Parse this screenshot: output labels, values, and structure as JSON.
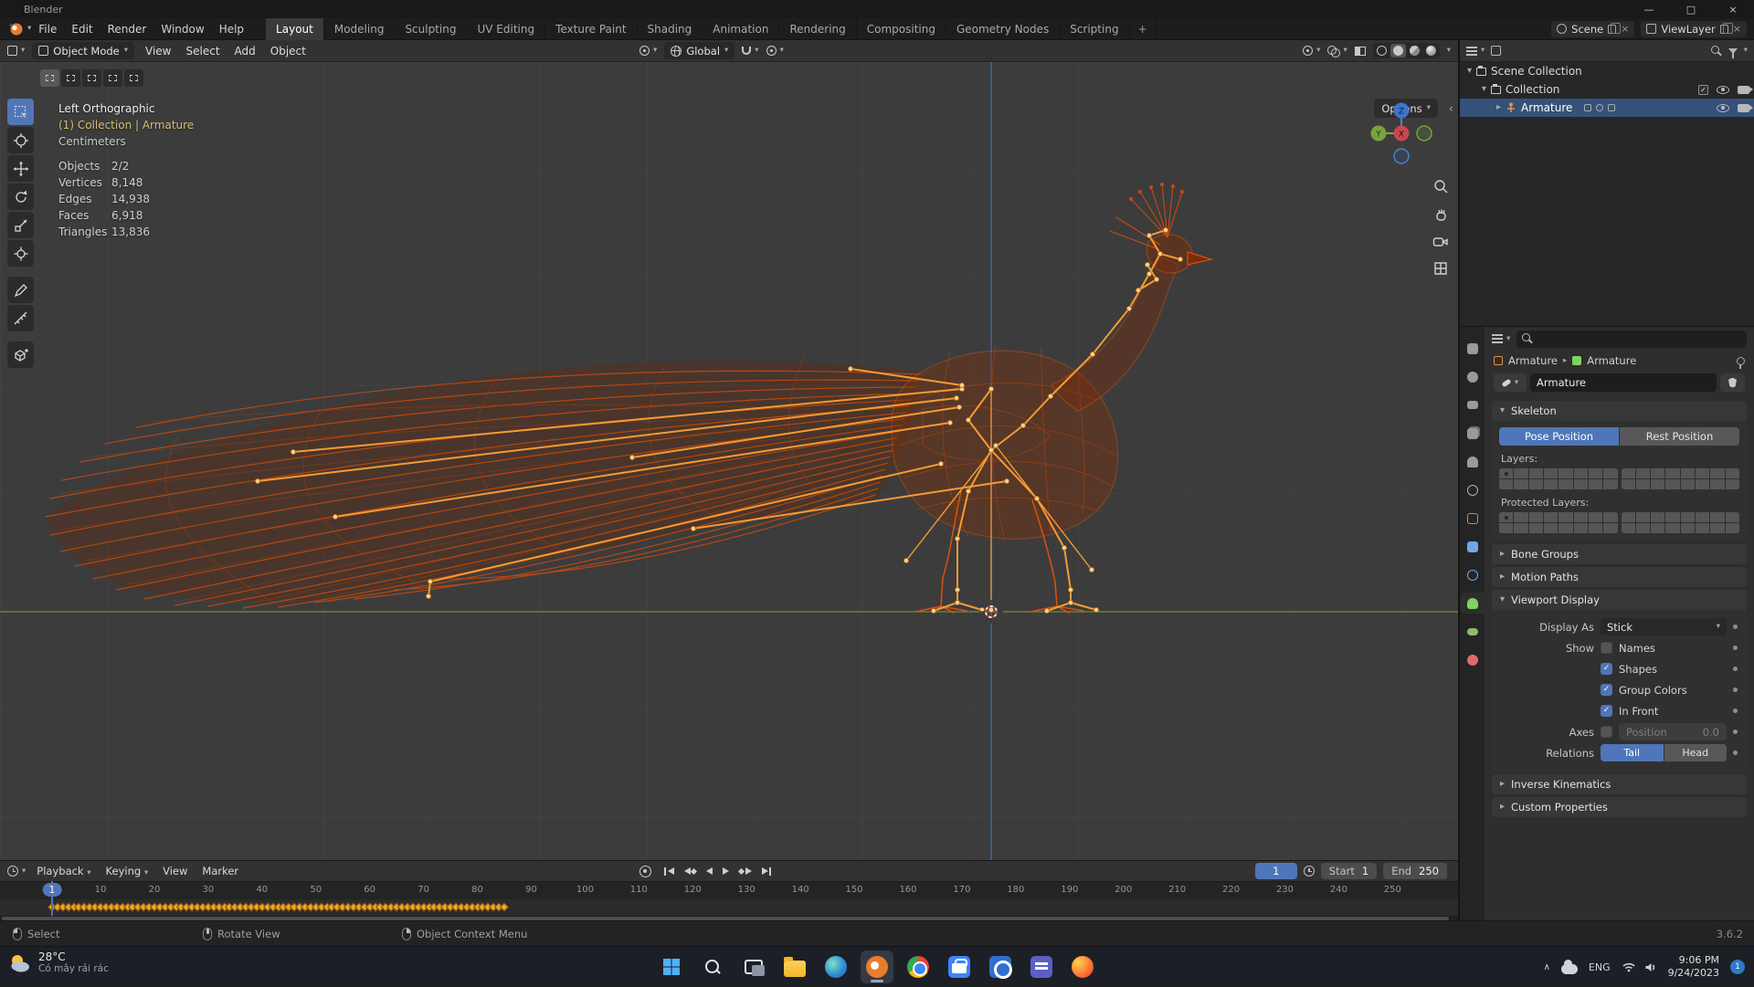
{
  "icons": {
    "chevron_down": "▾",
    "chevron_right": "▸",
    "chevron_left": "‹",
    "chevron_up": "∧",
    "check": "✓",
    "close": "×",
    "minimize": "—",
    "maximize": "□",
    "plus": "+"
  },
  "titlebar": {
    "app_name": "Blender"
  },
  "menubar": {
    "menus": [
      "File",
      "Edit",
      "Render",
      "Window",
      "Help"
    ],
    "workspaces": [
      "Layout",
      "Modeling",
      "Sculpting",
      "UV Editing",
      "Texture Paint",
      "Shading",
      "Animation",
      "Rendering",
      "Compositing",
      "Geometry Nodes",
      "Scripting"
    ],
    "scene_selector": {
      "label": "Scene"
    },
    "viewlayer_selector": {
      "label": "ViewLayer"
    }
  },
  "viewport": {
    "header": {
      "mode": "Object Mode",
      "menus": [
        "View",
        "Select",
        "Add",
        "Object"
      ],
      "orientation": "Global",
      "options_label": "Options"
    },
    "overlay": {
      "view_name": "Left Orthographic",
      "context": "(1) Collection | Armature",
      "units": "Centimeters",
      "stats": [
        {
          "label": "Objects",
          "value": "2/2"
        },
        {
          "label": "Vertices",
          "value": "8,148"
        },
        {
          "label": "Edges",
          "value": "14,938"
        },
        {
          "label": "Faces",
          "value": "6,918"
        },
        {
          "label": "Triangles",
          "value": "13,836"
        }
      ]
    },
    "gizmo": {
      "x": "X",
      "y": "Y",
      "z": "Z"
    }
  },
  "outliner": {
    "rows": [
      {
        "label": "Scene Collection"
      },
      {
        "label": "Collection"
      },
      {
        "label": "Armature"
      }
    ]
  },
  "properties": {
    "breadcrumb": {
      "object": "Armature",
      "data": "Armature"
    },
    "name_value": "Armature",
    "skeleton": {
      "title": "Skeleton",
      "pose_position": "Pose Position",
      "rest_position": "Rest Position",
      "layers_label": "Layers:",
      "protected_layers_label": "Protected Layers:",
      "layer_grid": {
        "blocks": 2,
        "cols": 8,
        "rows": 2
      }
    },
    "sections": {
      "bone_groups": "Bone Groups",
      "motion_paths": "Motion Paths",
      "viewport_display": "Viewport Display",
      "inverse_kinematics": "Inverse Kinematics",
      "custom_properties": "Custom Properties"
    },
    "viewport_display": {
      "display_as_label": "Display As",
      "display_as_value": "Stick",
      "show_label": "Show",
      "checkboxes": [
        {
          "label": "Names",
          "checked": false
        },
        {
          "label": "Shapes",
          "checked": true
        },
        {
          "label": "Group Colors",
          "checked": true
        },
        {
          "label": "In Front",
          "checked": true
        }
      ],
      "axes_label": "Axes",
      "position_label": "Position",
      "position_value": "0.0",
      "relations_label": "Relations",
      "tail": "Tail",
      "head": "Head"
    }
  },
  "timeline": {
    "menus": [
      "Playback",
      "Keying",
      "View",
      "Marker"
    ],
    "current_frame": "1",
    "start_label": "Start",
    "start_value": "1",
    "end_label": "End",
    "end_value": "250",
    "ticks": [
      10,
      20,
      30,
      40,
      50,
      60,
      70,
      80,
      90,
      100,
      110,
      120,
      130,
      140,
      150,
      160,
      170,
      180,
      190,
      200,
      210,
      220,
      230,
      240,
      250
    ],
    "keyframes": {
      "first": 1,
      "last": 85
    }
  },
  "statusbar": {
    "hints": [
      {
        "label": "Select"
      },
      {
        "label": "Rotate View"
      },
      {
        "label": "Object Context Menu"
      }
    ],
    "version": "3.6.2"
  },
  "taskbar": {
    "weather": {
      "temp": "28°C",
      "condition": "Có mây rải rác"
    },
    "tray": {
      "language": "ENG",
      "time": "9:06 PM",
      "date": "9/24/2023",
      "notification_count": "1"
    }
  }
}
